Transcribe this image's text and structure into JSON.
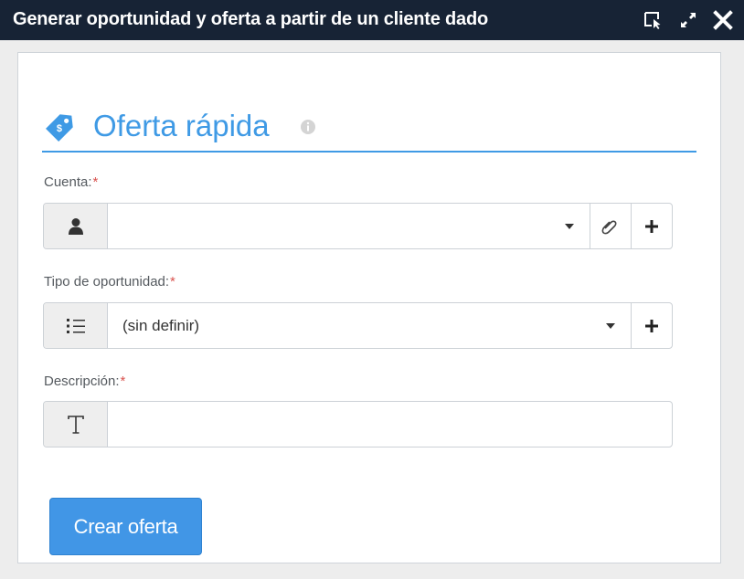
{
  "window": {
    "title": "Generar oportunidad y oferta a partir de un cliente dado",
    "icons": [
      "select-window-icon",
      "expand-icon",
      "close-icon"
    ]
  },
  "section": {
    "title": "Oferta rápida",
    "icon": "price-tag-icon",
    "info_icon": "info-icon"
  },
  "form": {
    "required_marker": "*",
    "account": {
      "label": "Cuenta:",
      "value": "",
      "addon_icon": "user-icon",
      "actions": [
        "dropdown-caret-icon",
        "link-icon",
        "plus-icon"
      ]
    },
    "opportunity_type": {
      "label": "Tipo de oportunidad:",
      "selected": "(sin definir)",
      "addon_icon": "list-icon",
      "actions": [
        "dropdown-caret-icon",
        "plus-icon"
      ]
    },
    "description": {
      "label": "Descripción:",
      "value": "",
      "addon_icon": "text-t-icon"
    }
  },
  "actions": {
    "create_label": "Crear oferta"
  },
  "colors": {
    "titlebar": "#172335",
    "accent": "#3f9ae5",
    "button": "#4196e6",
    "required": "#d9534f"
  }
}
